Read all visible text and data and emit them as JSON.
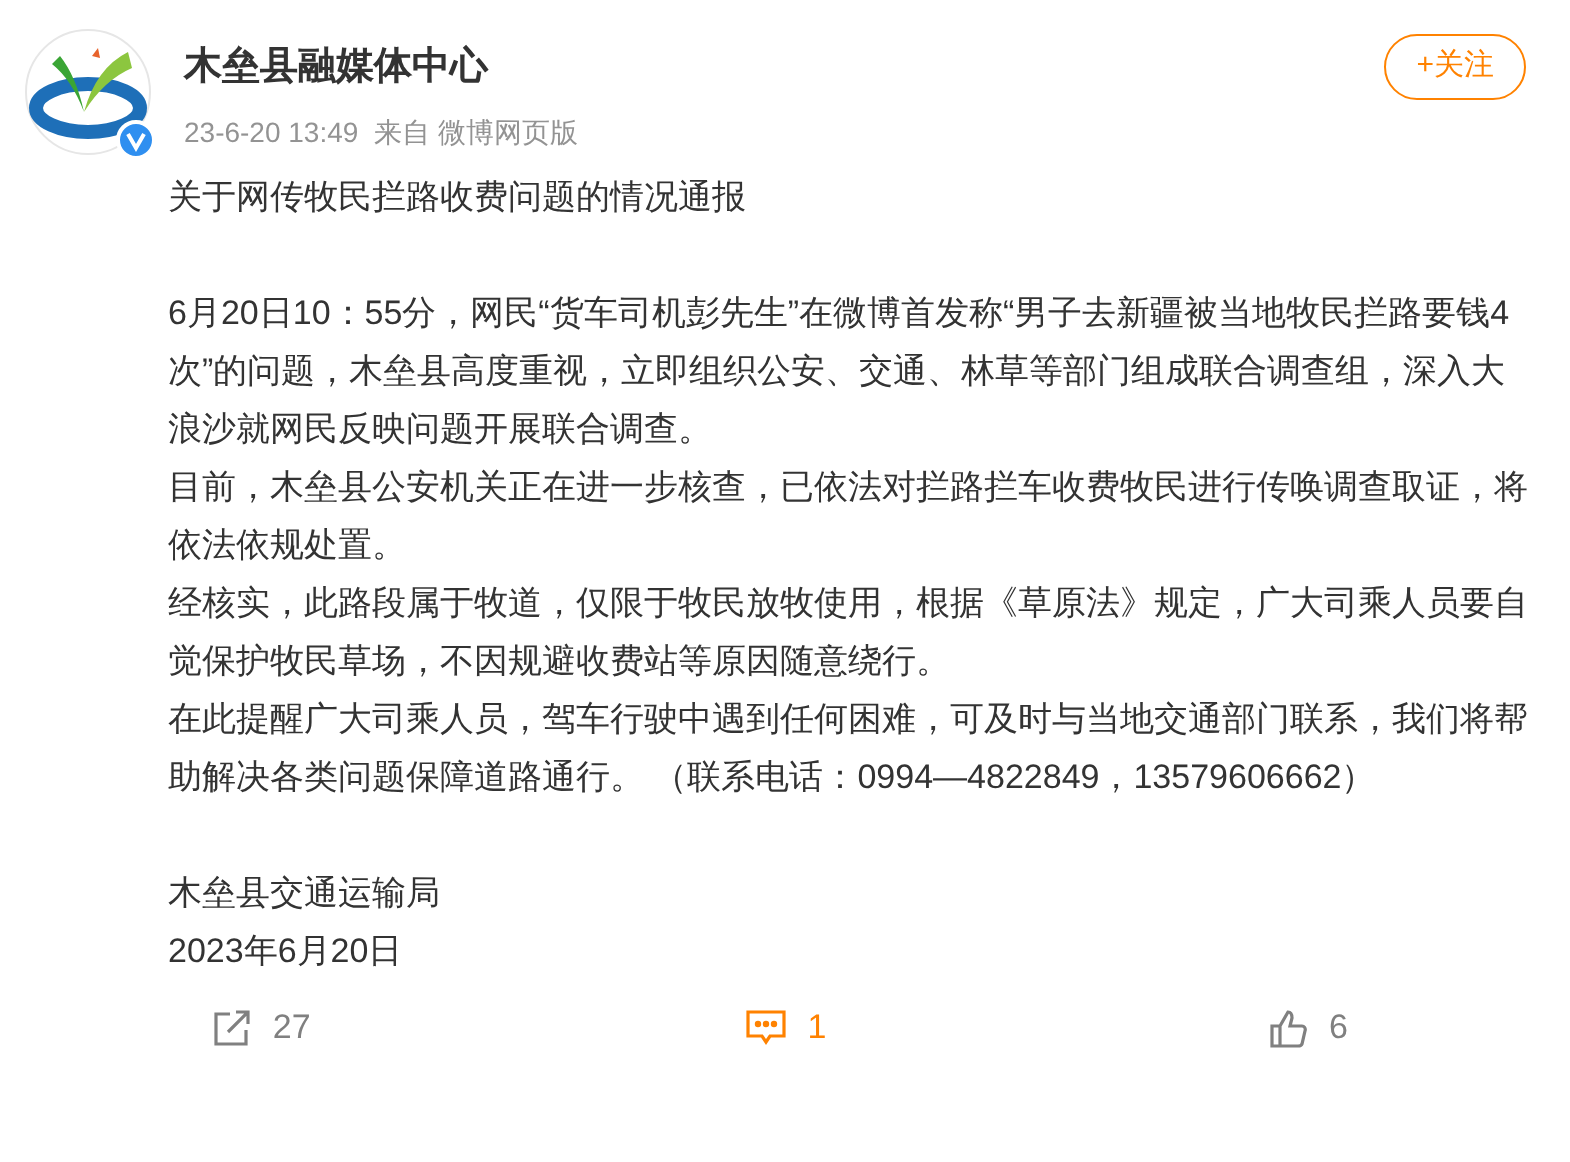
{
  "post": {
    "author": "木垒县融媒体中心",
    "verified": true,
    "time": "23-6-20 13:49",
    "source": "来自 微博网页版",
    "follow_button": "+关注",
    "paragraphs": [
      {
        "kind": "text",
        "text": "关于网传牧民拦路收费问题的情况通报"
      },
      {
        "kind": "blank"
      },
      {
        "kind": "text",
        "text": "6月20日10：55分，网民“货车司机彭先生”在微博首发称“男子去新疆被当地牧民拦路要钱4次”的问题，木垒县高度重视，立即组织公安、交通、林草等部门组成联合调查组，深入大浪沙就网民反映问题开展联合调查。"
      },
      {
        "kind": "text",
        "text": "目前，木垒县公安机关正在进一步核查，已依法对拦路拦车收费牧民进行传唤调查取证，将依法依规处置。"
      },
      {
        "kind": "text",
        "text": "经核实，此路段属于牧道，仅限于牧民放牧使用，根据《草原法》规定，广大司乘人员要自觉保护牧民草场，不因规避收费站等原因随意绕行。"
      },
      {
        "kind": "text",
        "text": "在此提醒广大司乘人员，驾车行驶中遇到任何困难，可及时与当地交通部门联系，我们将帮助解决各类问题保障道路通行。 （联系电话：0994—4822849，13579606662）"
      },
      {
        "kind": "blank"
      },
      {
        "kind": "text",
        "text": "木垒县交通运输局"
      },
      {
        "kind": "text",
        "text": "2023年6月20日"
      }
    ]
  },
  "actions": [
    {
      "kind": "repost",
      "count": "27",
      "selected": false
    },
    {
      "kind": "comment",
      "count": "1",
      "selected": true
    },
    {
      "kind": "like",
      "count": "6",
      "selected": false
    }
  ]
}
